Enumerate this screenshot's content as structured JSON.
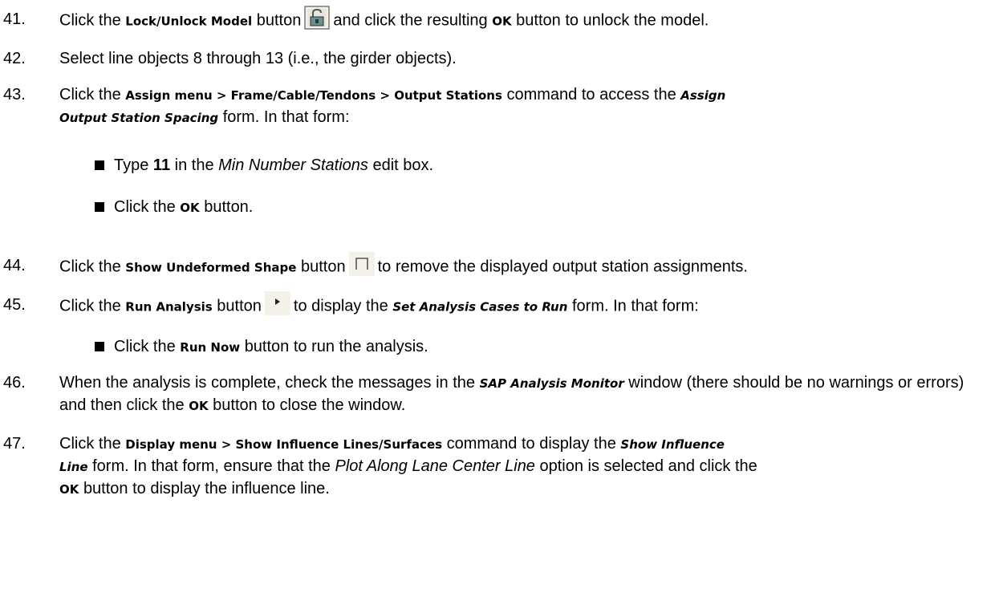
{
  "steps": {
    "s41": {
      "num": "41.",
      "t1": "Click the",
      "cmd": "Lock/Unlock Model",
      "t2": "button",
      "t3": "and click the resulting",
      "ok": "OK",
      "t4": "button to unlock the model.",
      "icon": "padlock-icon"
    },
    "s42": {
      "num": "42.",
      "text": "Select line objects 8 through 13 (i.e., the girder objects)."
    },
    "s43": {
      "num": "43.",
      "t1": "Click the",
      "cmd": "Assign menu > Frame/Cable/Tendons > Output Stations",
      "t2": "command to access the",
      "form1": "Assign",
      "form2": "Output Station Spacing",
      "t3": "form. In that form:",
      "b1": {
        "t1": "Type",
        "val": "11",
        "t2": "in the",
        "field": "Min Number Stations",
        "t3": "edit box."
      },
      "b2": {
        "t1": "Click the",
        "ok": "OK",
        "t2": "button."
      }
    },
    "s44": {
      "num": "44.",
      "t1": "Click the",
      "cmd": "Show Undeformed Shape",
      "t2": "button",
      "t3": "to remove the displayed output station assignments.",
      "icon": "undeformed-shape-icon"
    },
    "s45": {
      "num": "45.",
      "t1": "Click the",
      "cmd": "Run Analysis",
      "t2": "button",
      "t3": "to display the",
      "form": "Set Analysis Cases to Run",
      "t4": "form. In that form:",
      "icon": "run-analysis-icon",
      "b1": {
        "t1": "Click the",
        "cmd": "Run Now",
        "t2": "button to run the analysis."
      }
    },
    "s46": {
      "num": "46.",
      "t1": "When the analysis is complete, check the messages in the",
      "form": "SAP Analysis Monitor",
      "t2": "window (there should be no warnings or errors) and then click the",
      "ok": "OK",
      "t3": "button to close the window."
    },
    "s47": {
      "num": "47.",
      "t1": "Click the",
      "cmd": "Display menu > Show Influence Lines/Surfaces",
      "t2": "command to display the",
      "form1": "Show Influence",
      "form2": "Line",
      "t3": "form. In that form, ensure that the",
      "opt": "Plot Along Lane Center Line",
      "t4": "option is selected and click the",
      "ok": "OK",
      "t5": "button to display the influence line."
    }
  }
}
